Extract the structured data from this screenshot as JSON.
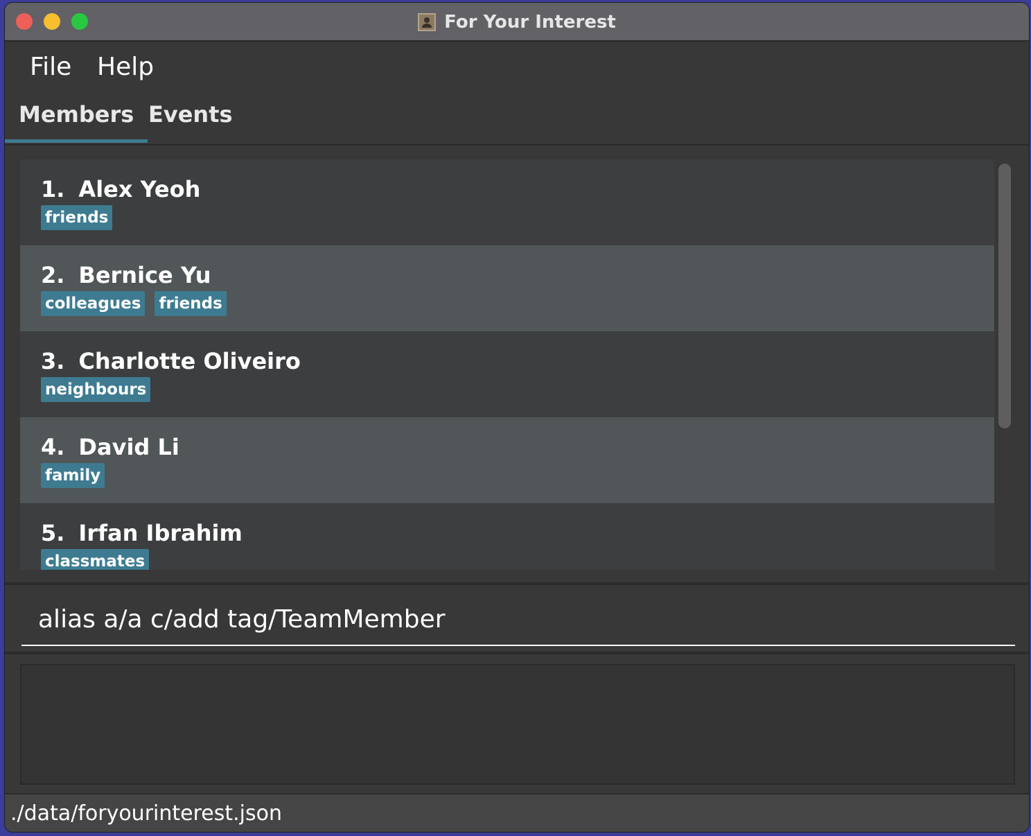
{
  "window": {
    "title": "For Your Interest"
  },
  "menu": {
    "file": "File",
    "help": "Help"
  },
  "tabs": [
    {
      "label": "Members",
      "active": true
    },
    {
      "label": "Events",
      "active": false
    }
  ],
  "members": [
    {
      "index": "1.",
      "name": "Alex Yeoh",
      "tags": [
        "friends"
      ]
    },
    {
      "index": "2.",
      "name": "Bernice Yu",
      "tags": [
        "colleagues",
        "friends"
      ]
    },
    {
      "index": "3.",
      "name": "Charlotte Oliveiro",
      "tags": [
        "neighbours"
      ]
    },
    {
      "index": "4.",
      "name": "David Li",
      "tags": [
        "family"
      ]
    },
    {
      "index": "5.",
      "name": "Irfan Ibrahim",
      "tags": [
        "classmates"
      ]
    }
  ],
  "command": {
    "value": "alias a/a c/add tag/TeamMember"
  },
  "result": {
    "text": ""
  },
  "status": {
    "path": "./data/foryourinterest.json"
  },
  "colors": {
    "tag_bg": "#3e7b91",
    "card_alt_bg": "#515658",
    "card_bg": "#3c3e3f",
    "tab_underline": "#3e7b91"
  },
  "icons": {
    "title_icon": "address-book-icon"
  }
}
